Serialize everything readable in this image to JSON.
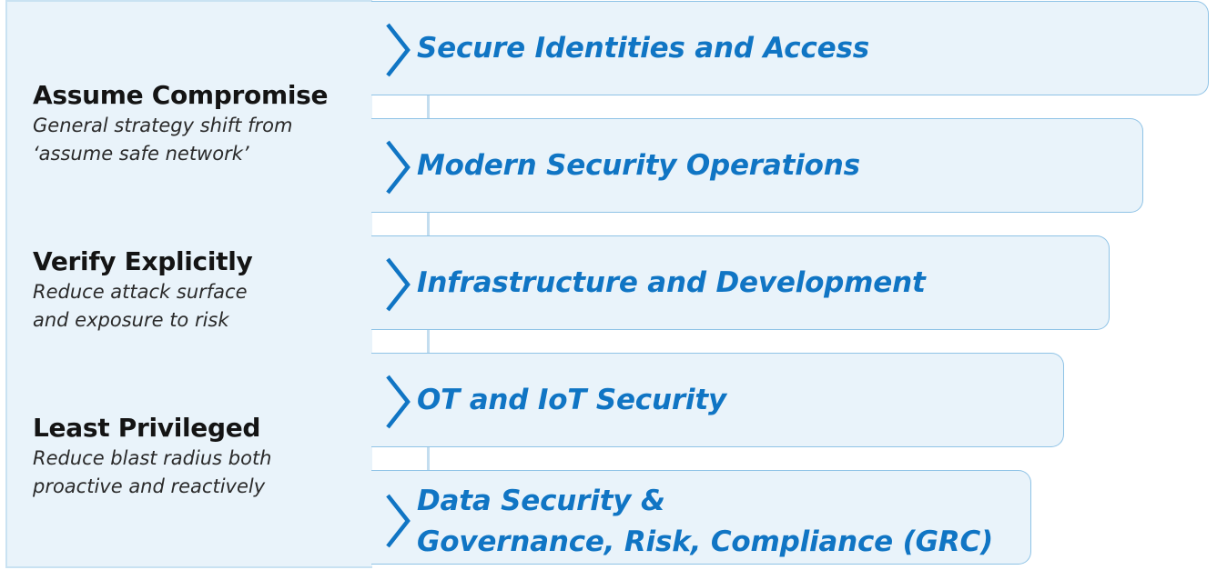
{
  "principles": [
    {
      "title": "Assume Compromise",
      "description": "General strategy shift from\n‘assume safe network’"
    },
    {
      "title": "Verify Explicitly",
      "description": "Reduce attack surface\nand exposure to risk"
    },
    {
      "title": "Least Privileged",
      "description": "Reduce blast radius both\nproactive and reactively"
    }
  ],
  "pillars": [
    {
      "label": "Secure Identities and Access"
    },
    {
      "label": "Modern Security Operations"
    },
    {
      "label": "Infrastructure and Development"
    },
    {
      "label": "OT and IoT Security"
    },
    {
      "label": "Data Security &\nGovernance, Risk, Compliance (GRC)"
    }
  ],
  "colors": {
    "panel_background": "#e9f3fa",
    "accent_text": "#1075c4",
    "pillar_border": "#8fc3e6",
    "connector": "#c3ddef"
  },
  "icons": {
    "pillar_marker": "chevron-right-icon"
  }
}
